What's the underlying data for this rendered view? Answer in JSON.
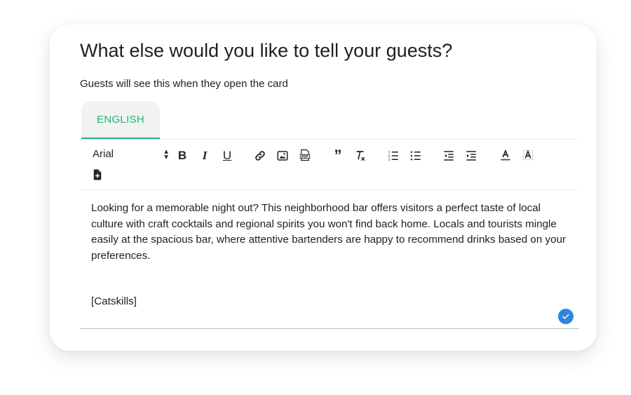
{
  "card": {
    "title": "What else would you like to tell your guests?",
    "subtitle": "Guests will see this when they open the card"
  },
  "tabs": [
    {
      "label": "ENGLISH",
      "active": true
    }
  ],
  "toolbar": {
    "font": "Arial",
    "bold": "B",
    "italic": "I",
    "underline": "U",
    "quote": "”",
    "icons": [
      "bold-icon",
      "italic-icon",
      "underline-icon",
      "link-icon",
      "image-icon",
      "pdf-icon",
      "blockquote-icon",
      "clear-format-icon",
      "ordered-list-icon",
      "bullet-list-icon",
      "outdent-icon",
      "indent-icon",
      "text-color-icon",
      "highlight-icon",
      "add-file-icon"
    ]
  },
  "editor": {
    "paragraph": "Looking for a memorable night out? This neighborhood bar offers visitors a perfect taste of local culture with craft cocktails and regional spirits you won't find back home. Locals and tourists mingle easily at the spacious bar, where attentive bartenders are happy to recommend drinks based on your preferences.",
    "tag": "[Catskills]"
  },
  "colors": {
    "accent": "#22b573",
    "check": "#2e86de"
  }
}
